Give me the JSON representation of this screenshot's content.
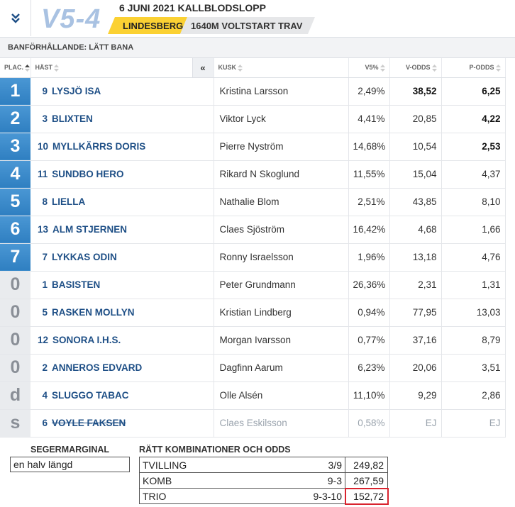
{
  "header": {
    "game_logo": "V5-4",
    "race_title": "6 JUNI 2021 KALLBLODSLOPP",
    "track": "LINDESBERG",
    "distance": "1640M VOLTSTART TRAV",
    "track_color": "#fbd133"
  },
  "conditions": "BANFÖRHÅLLANDE: LÄTT BANA",
  "table": {
    "columns": {
      "place": "PLAC.",
      "horse": "HÄST",
      "driver": "KUSK",
      "v5pct": "V5%",
      "vodds": "V-ODDS",
      "podds": "P-ODDS"
    },
    "expand_label": "«",
    "rows": [
      {
        "place": "1",
        "no": "9",
        "horse": "LYSJÖ ISA",
        "driver": "Kristina Larsson",
        "v5pct": "2,49%",
        "vodds": "38,52",
        "podds": "6,25"
      },
      {
        "place": "2",
        "no": "3",
        "horse": "BLIXTEN",
        "driver": "Viktor Lyck",
        "v5pct": "4,41%",
        "vodds": "20,85",
        "podds": "4,22"
      },
      {
        "place": "3",
        "no": "10",
        "horse": "MYLLKÄRRS DORIS",
        "driver": "Pierre Nyström",
        "v5pct": "14,68%",
        "vodds": "10,54",
        "podds": "2,53"
      },
      {
        "place": "4",
        "no": "11",
        "horse": "SUNDBO HERO",
        "driver": "Rikard N Skoglund",
        "v5pct": "11,55%",
        "vodds": "15,04",
        "podds": "4,37"
      },
      {
        "place": "5",
        "no": "8",
        "horse": "LIELLA",
        "driver": "Nathalie Blom",
        "v5pct": "2,51%",
        "vodds": "43,85",
        "podds": "8,10"
      },
      {
        "place": "6",
        "no": "13",
        "horse": "ALM STJERNEN",
        "driver": "Claes Sjöström",
        "v5pct": "16,42%",
        "vodds": "4,68",
        "podds": "1,66"
      },
      {
        "place": "7",
        "no": "7",
        "horse": "LYKKAS ODIN",
        "driver": "Ronny Israelsson",
        "v5pct": "1,96%",
        "vodds": "13,18",
        "podds": "4,76"
      },
      {
        "place": "0",
        "no": "1",
        "horse": "BASISTEN",
        "driver": "Peter Grundmann",
        "v5pct": "26,36%",
        "vodds": "2,31",
        "podds": "1,31"
      },
      {
        "place": "0",
        "no": "5",
        "horse": "RASKEN MOLLYN",
        "driver": "Kristian Lindberg",
        "v5pct": "0,94%",
        "vodds": "77,95",
        "podds": "13,03"
      },
      {
        "place": "0",
        "no": "12",
        "horse": "SONORA I.H.S.",
        "driver": "Morgan Ivarsson",
        "v5pct": "0,77%",
        "vodds": "37,16",
        "podds": "8,79"
      },
      {
        "place": "0",
        "no": "2",
        "horse": "ANNEROS EDVARD",
        "driver": "Dagfinn Aarum",
        "v5pct": "6,23%",
        "vodds": "20,06",
        "podds": "3,51"
      },
      {
        "place": "d",
        "no": "4",
        "horse": "SLUGGO TABAC",
        "driver": "Olle Alsén",
        "v5pct": "11,10%",
        "vodds": "9,29",
        "podds": "2,86"
      },
      {
        "place": "s",
        "no": "6",
        "horse": "VOYLE FAKSEN",
        "driver": "Claes Eskilsson",
        "v5pct": "0,58%",
        "vodds": "EJ",
        "podds": "EJ"
      }
    ]
  },
  "segermarginal": {
    "title": "SEGERMARGINAL",
    "value": "en halv längd"
  },
  "combinations": {
    "title": "RÄTT KOMBINATIONER OCH ODDS",
    "rows": [
      {
        "name": "TVILLING",
        "pattern": "3/9",
        "odds": "249,82"
      },
      {
        "name": "KOMB",
        "pattern": "9-3",
        "odds": "267,59"
      },
      {
        "name": "TRIO",
        "pattern": "9-3-10",
        "odds": "152,72"
      }
    ]
  }
}
